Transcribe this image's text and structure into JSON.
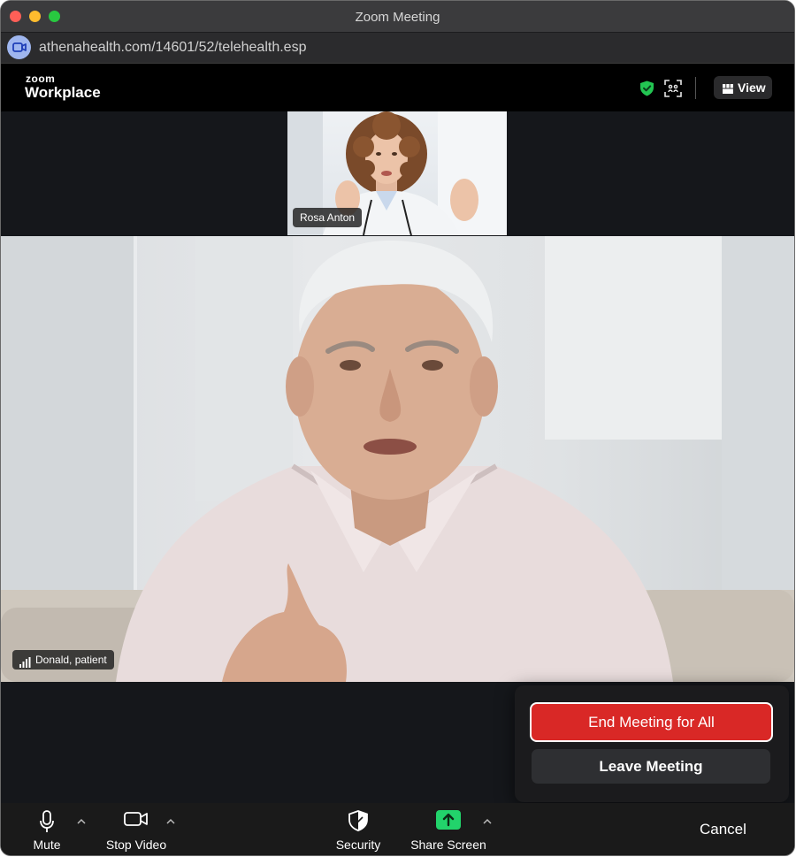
{
  "window": {
    "title": "Zoom Meeting"
  },
  "address_bar": {
    "url": "athenahealth.com/14601/52/telehealth.esp"
  },
  "header": {
    "logo_top": "zoom",
    "logo_bottom": "Workplace",
    "view_label": "View",
    "icons": [
      "shield-check-icon",
      "focus-icon",
      "grid-icon"
    ]
  },
  "participants": {
    "top_tile_name": "Rosa Anton",
    "main_tile_name": "Donald, patient"
  },
  "end_menu": {
    "end_all_label": "End Meeting for All",
    "leave_label": "Leave Meeting"
  },
  "toolbar": {
    "mute_label": "Mute",
    "stop_video_label": "Stop Video",
    "security_label": "Security",
    "share_screen_label": "Share Screen",
    "cancel_label": "Cancel"
  },
  "colors": {
    "end_button": "#d92826",
    "share_accent": "#22d36b",
    "shield_green": "#23c552"
  }
}
